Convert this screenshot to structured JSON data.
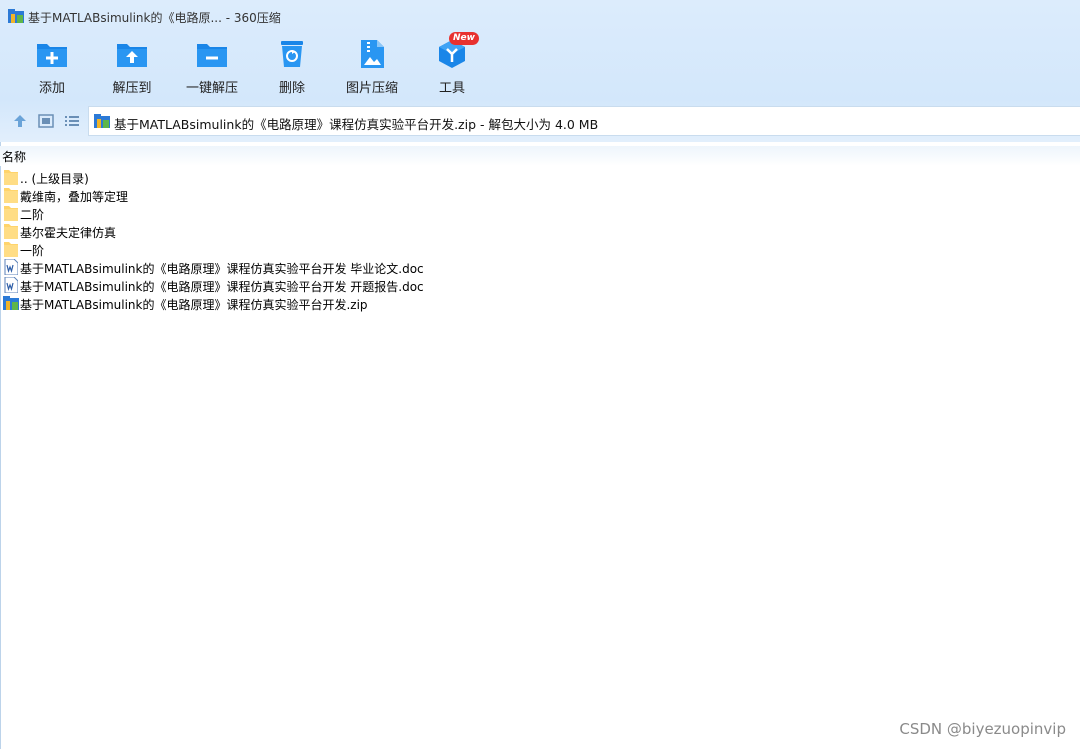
{
  "window": {
    "title": "基于MATLABsimulink的《电路原... - 360压缩"
  },
  "toolbar": {
    "items": [
      {
        "label": "添加",
        "icon": "folder-add-icon"
      },
      {
        "label": "解压到",
        "icon": "folder-extract-icon"
      },
      {
        "label": "一键解压",
        "icon": "folder-quick-extract-icon"
      },
      {
        "label": "删除",
        "icon": "trash-icon"
      },
      {
        "label": "图片压缩",
        "icon": "image-compress-icon"
      },
      {
        "label": "工具",
        "icon": "tools-icon",
        "badge": "New"
      }
    ]
  },
  "addressbar": {
    "path": "基于MATLABsimulink的《电路原理》课程仿真实验平台开发.zip - 解包大小为 4.0 MB"
  },
  "list": {
    "column_name": "名称",
    "items": [
      {
        "name": ".. (上级目录)",
        "type": "folder"
      },
      {
        "name": "戴维南，叠加等定理",
        "type": "folder"
      },
      {
        "name": "二阶",
        "type": "folder"
      },
      {
        "name": "基尔霍夫定律仿真",
        "type": "folder"
      },
      {
        "name": "一阶",
        "type": "folder"
      },
      {
        "name": "基于MATLABsimulink的《电路原理》课程仿真实验平台开发 毕业论文.doc",
        "type": "doc"
      },
      {
        "name": "基于MATLABsimulink的《电路原理》课程仿真实验平台开发 开题报告.doc",
        "type": "doc"
      },
      {
        "name": "基于MATLABsimulink的《电路原理》课程仿真实验平台开发.zip",
        "type": "zip"
      }
    ]
  },
  "watermark": "CSDN @biyezuopinvip",
  "colors": {
    "accent": "#1e8fe6",
    "folder": "#ffd46b",
    "badge": "#e8312f"
  }
}
